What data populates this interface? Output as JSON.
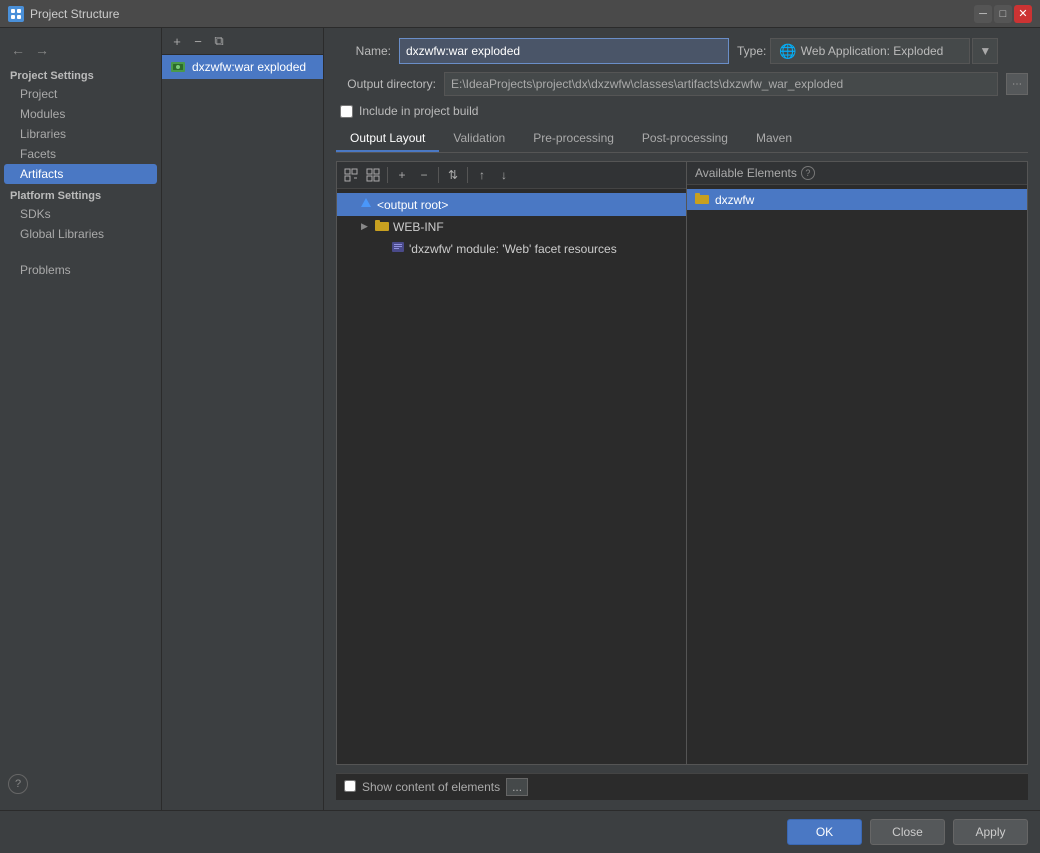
{
  "titleBar": {
    "title": "Project Structure",
    "closeBtn": "✕",
    "minBtn": "─",
    "maxBtn": "□"
  },
  "sidebar": {
    "nav": {
      "backBtn": "←",
      "fwdBtn": "→"
    },
    "projectSettings": {
      "label": "Project Settings",
      "items": [
        {
          "id": "project",
          "label": "Project"
        },
        {
          "id": "modules",
          "label": "Modules"
        },
        {
          "id": "libraries",
          "label": "Libraries"
        },
        {
          "id": "facets",
          "label": "Facets"
        },
        {
          "id": "artifacts",
          "label": "Artifacts"
        }
      ]
    },
    "platformSettings": {
      "label": "Platform Settings",
      "items": [
        {
          "id": "sdks",
          "label": "SDKs"
        },
        {
          "id": "global-libraries",
          "label": "Global Libraries"
        }
      ]
    },
    "otherItems": [
      {
        "id": "problems",
        "label": "Problems"
      }
    ]
  },
  "artifactList": {
    "toolbar": {
      "addBtn": "+",
      "removeBtn": "−",
      "copyBtn": "⧉"
    },
    "items": [
      {
        "id": "dxzwfw-war-exploded",
        "label": "dxzwfw:war exploded"
      }
    ]
  },
  "configPanel": {
    "nameLabel": "Name:",
    "nameValue": "dxzwfw:war exploded",
    "typeLabel": "Type:",
    "typeValue": "🌐  Web Application: Exploded",
    "outputDirLabel": "Output directory:",
    "outputDirValue": "E:\\IdeaProjects\\project\\dx\\dxzwfw\\classes\\artifacts\\dxzwfw_war_exploded",
    "includeBuildLabel": "Include in project build",
    "includeBuildChecked": false
  },
  "tabs": [
    {
      "id": "output-layout",
      "label": "Output Layout",
      "active": true
    },
    {
      "id": "validation",
      "label": "Validation"
    },
    {
      "id": "pre-processing",
      "label": "Pre-processing"
    },
    {
      "id": "post-processing",
      "label": "Post-processing"
    },
    {
      "id": "maven",
      "label": "Maven"
    }
  ],
  "layoutPanel": {
    "treeToolbar": {
      "expandBtn": "⊞",
      "collapseBtn": "⊟",
      "addBtn": "+",
      "removeBtn": "−",
      "sortBtn": "⇅",
      "upBtn": "↑",
      "downBtn": "↓"
    },
    "treeItems": [
      {
        "id": "output-root",
        "label": "<output root>",
        "indent": 0,
        "selected": true,
        "icon": "🔷",
        "expandable": false
      },
      {
        "id": "web-inf",
        "label": "WEB-INF",
        "indent": 1,
        "selected": false,
        "icon": "📁",
        "expandable": true
      },
      {
        "id": "web-facet",
        "label": "'dxzwfw' module: 'Web' facet resources",
        "indent": 2,
        "selected": false,
        "icon": "🔧",
        "expandable": false
      }
    ],
    "elementsHeader": "Available Elements",
    "helpIcon": "?",
    "elements": [
      {
        "id": "dxzwfw",
        "label": "dxzwfw",
        "icon": "📁",
        "selected": true
      }
    ],
    "bottomBar": {
      "showContentLabel": "Show content of elements",
      "showContentChecked": false,
      "dotsBtn": "..."
    }
  },
  "footer": {
    "okLabel": "OK",
    "closeLabel": "Close",
    "applyLabel": "Apply"
  }
}
